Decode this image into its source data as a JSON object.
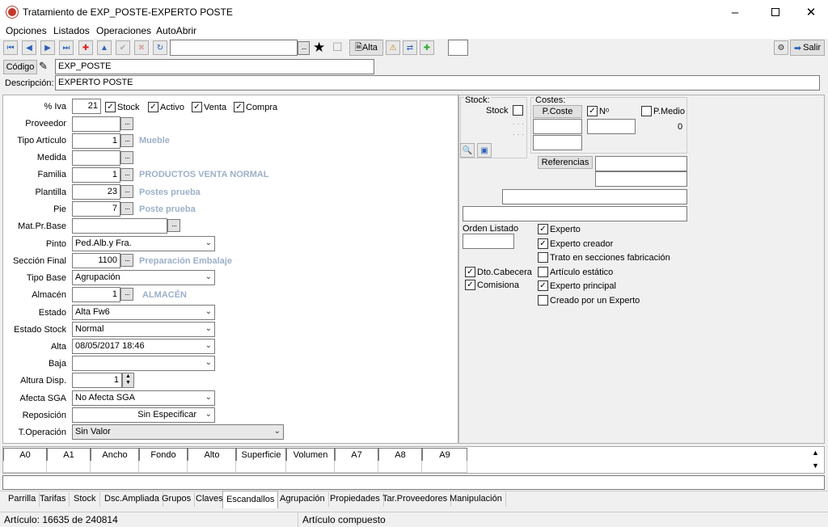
{
  "window": {
    "title": "Tratamiento de EXP_POSTE-EXPERTO POSTE"
  },
  "menu": [
    "Opciones",
    "Listados",
    "Operaciones",
    "AutoAbrir"
  ],
  "toolbar": {
    "search_value": "",
    "search_dots": "···",
    "alta_label": "Alta",
    "salir_label": "Salir"
  },
  "header": {
    "codigo_label": "Código",
    "codigo_value": "EXP_POSTE",
    "descripcion_label": "Descripción:",
    "descripcion_value": "EXPERTO POSTE"
  },
  "form": {
    "iva_label": "% Iva",
    "iva_value": "21",
    "stock_label": "Stock",
    "activo_label": "Activo",
    "venta_label": "Venta",
    "compra_label": "Compra",
    "proveedor_label": "Proveedor",
    "tipo_articulo_label": "Tipo Artículo",
    "tipo_articulo_value": "1",
    "tipo_articulo_hint": "Mueble",
    "medida_label": "Medida",
    "familia_label": "Familia",
    "familia_value": "1",
    "familia_hint": "PRODUCTOS VENTA NORMAL",
    "plantilla_label": "Plantilla",
    "plantilla_value": "23",
    "plantilla_hint": "Postes prueba",
    "pie_label": "Pie",
    "pie_value": "7",
    "pie_hint": "Poste prueba",
    "matprbase_label": "Mat.Pr.Base",
    "pinto_label": "Pinto",
    "pinto_value": "Ped.Alb.y Fra.",
    "seccion_label": "Sección Final",
    "seccion_value": "1100",
    "seccion_hint": "Preparación Embalaje",
    "tipobase_label": "Tipo Base",
    "tipobase_value": "Agrupación",
    "almacen_label": "Almacén",
    "almacen_value": "1",
    "almacen_hint": "ALMACÉN",
    "estado_label": "Estado",
    "estado_value": "Alta Fw6",
    "estadostock_label": "Estado Stock",
    "estadostock_value": "Normal",
    "alta_label": "Alta",
    "alta_value": "08/05/2017 18:46",
    "baja_label": "Baja",
    "baja_value": "",
    "altura_label": "Altura Disp.",
    "altura_value": "1",
    "afecta_label": "Afecta SGA",
    "afecta_value": "No Afecta SGA",
    "reposicion_label": "Reposición",
    "reposicion_value": "Sin Especificar",
    "toperacion_label": "T.Operación",
    "toperacion_value": "Sin Valor"
  },
  "right": {
    "stock_group": "Stock:",
    "stock_label": "Stock",
    "stock_dots1": "· · ·",
    "stock_dots2": "· · ·",
    "costes_group": "Costes:",
    "pcoste_btn": "P.Coste",
    "n_label": "Nᵒ",
    "pmedio_label": "P.Medio",
    "pmedio_value": "0",
    "referencias_btn": "Referencias",
    "orden_label": "Orden Listado",
    "dto_label": "Dto.Cabecera",
    "comisiona_label": "Comisiona",
    "checks": [
      "Experto",
      "Experto creador",
      "Trato en secciones fabricación",
      "Artículo estático",
      "Experto principal",
      "Creado por un Experto"
    ]
  },
  "grid": {
    "headers": [
      "A0",
      "A1",
      "Ancho",
      "Fondo",
      "Alto",
      "Superficie",
      "Volumen",
      "A7",
      "A8",
      "A9"
    ]
  },
  "tabs": [
    "Parrilla",
    "Tarifas",
    "Stock",
    "Dsc.Ampliada",
    "Grupos",
    "Claves",
    "Escandallos",
    "Agrupación",
    "Propiedades",
    "Tar.Proveedores",
    "Manipulación"
  ],
  "status": {
    "left": "Artículo: 16635 de 240814",
    "right": "Artículo compuesto"
  }
}
